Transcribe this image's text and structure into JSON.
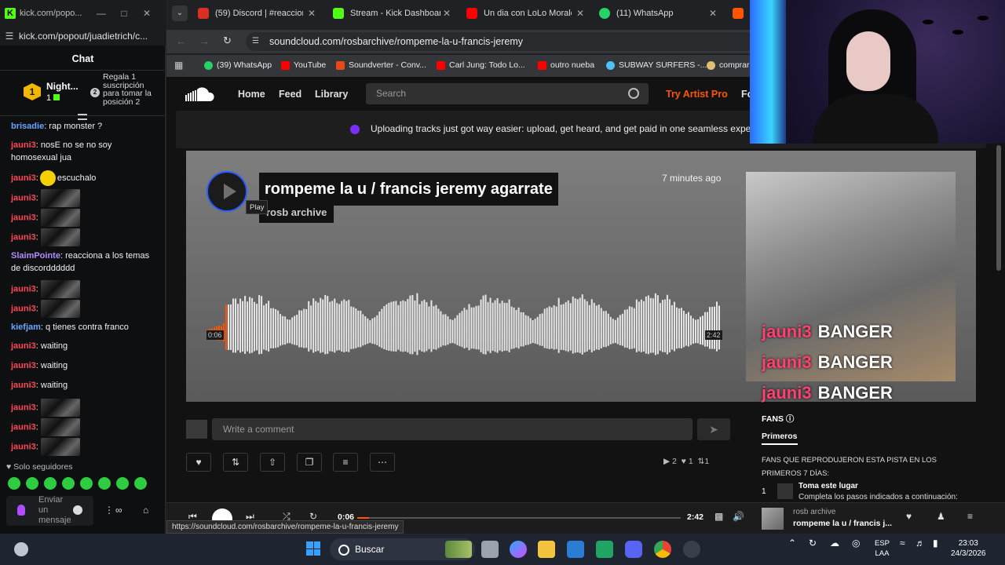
{
  "kick": {
    "window_title": "kick.com/popo...",
    "url": "kick.com/popout/juadietrich/c...",
    "chat_header": "Chat",
    "leader": {
      "rank1": "1",
      "name": "Night...",
      "count": "1",
      "rank2": "2",
      "gift_text": "Regala 1 suscripción para tomar la posición 2"
    },
    "messages": [
      {
        "user": "brisadie",
        "color": "blue",
        "text": ": rap monster ?"
      },
      {
        "user": "jauni3",
        "color": "red",
        "text": ": nosE no se no soy homosexual jua"
      },
      {
        "user": "jauni3",
        "color": "red",
        "text": "escuchalo",
        "face": true
      },
      {
        "user": "jauni3",
        "color": "red",
        "text": "",
        "emote": true
      },
      {
        "user": "jauni3",
        "color": "red",
        "text": "",
        "emote": true
      },
      {
        "user": "jauni3",
        "color": "red",
        "text": "",
        "emote": true
      },
      {
        "user": "SlaimPointe",
        "color": "purple",
        "text": ": reacciona a los temas de discordddddd"
      },
      {
        "user": "jauni3",
        "color": "red",
        "text": "",
        "emote": true
      },
      {
        "user": "jauni3",
        "color": "red",
        "text": "",
        "emote": true
      },
      {
        "user": "kiefjam",
        "color": "blue",
        "text": ": q tienes contra franco"
      },
      {
        "user": "jauni3",
        "color": "red",
        "text": ": waiting"
      },
      {
        "user": "jauni3",
        "color": "red",
        "text": ": waiting"
      },
      {
        "user": "jauni3",
        "color": "red",
        "text": ": waiting"
      },
      {
        "user": "jauni3",
        "color": "red",
        "text": "",
        "emote": true
      },
      {
        "user": "jauni3",
        "color": "red",
        "text": "",
        "emote": true
      },
      {
        "user": "jauni3",
        "color": "red",
        "text": "",
        "emote": true
      }
    ],
    "followers_only": "Solo seguidores",
    "send_placeholder": "Enviar un mensaje"
  },
  "browser": {
    "tabs": [
      {
        "title": "(59) Discord | #reaccione",
        "color": "#d93025"
      },
      {
        "title": "Stream - Kick Dashboard",
        "color": "#53fc18"
      },
      {
        "title": "Un dia con LoLo Morales",
        "color": "#ff0000"
      },
      {
        "title": "(11) WhatsApp",
        "color": "#25d366"
      }
    ],
    "url": "soundcloud.com/rosbarchive/rompeme-la-u-francis-jeremy",
    "bookmarks": [
      {
        "label": "(39) WhatsApp",
        "color": "#25d366"
      },
      {
        "label": "YouTube",
        "color": "#ff0000"
      },
      {
        "label": "Soundverter - Conv...",
        "color": "#e64a19"
      },
      {
        "label": "Carl Jung: Todo Lo...",
        "color": "#ff0000"
      },
      {
        "label": "outro nueba",
        "color": "#ff0000"
      },
      {
        "label": "SUBWAY SURFERS -...",
        "color": "#4fc3f7"
      },
      {
        "label": "comprar",
        "color": "#e0c070"
      }
    ]
  },
  "soundcloud": {
    "nav": {
      "home": "Home",
      "feed": "Feed",
      "library": "Library",
      "search_placeholder": "Search",
      "artist_pro": "Try Artist Pro",
      "more": "Fo"
    },
    "banner": "Uploading tracks just got way easier: upload, get heard, and get paid in one seamless experien",
    "track": {
      "title": "rompeme la u / francis jeremy agarrate",
      "artist": "rosb archive",
      "time_ago": "7 minutes ago",
      "tooltip": "Play",
      "elapsed": "0:06",
      "duration": "2:42",
      "progress": 0.037
    },
    "overlay_banger": [
      {
        "user": "jauni3",
        "text": "BANGER"
      },
      {
        "user": "jauni3",
        "text": "BANGER"
      },
      {
        "user": "jauni3",
        "text": "BANGER"
      }
    ],
    "comment_placeholder": "Write a comment",
    "stats": {
      "plays": "2",
      "likes": "1",
      "reposts": "1"
    },
    "fans": {
      "label": "FANS",
      "tab": "Primeros",
      "desc": "FANS QUE REPRODUJERON ESTA PISTA EN LOS PRIMEROS 7 DÍAS:",
      "rank": "1",
      "title": "Toma este lugar",
      "subtitle": "Completa los pasos indicados a continuación:"
    },
    "player": {
      "elapsed": "0:06",
      "duration": "2:42",
      "artist": "rosb archive",
      "title": "rompeme la u / francis j..."
    },
    "status_url": "https://soundcloud.com/rosbarchive/rompeme-la-u-francis-jeremy"
  },
  "taskbar": {
    "search": "Buscar",
    "lang1": "ESP",
    "lang2": "LAA",
    "time": "23:03",
    "date": "24/3/2026"
  }
}
